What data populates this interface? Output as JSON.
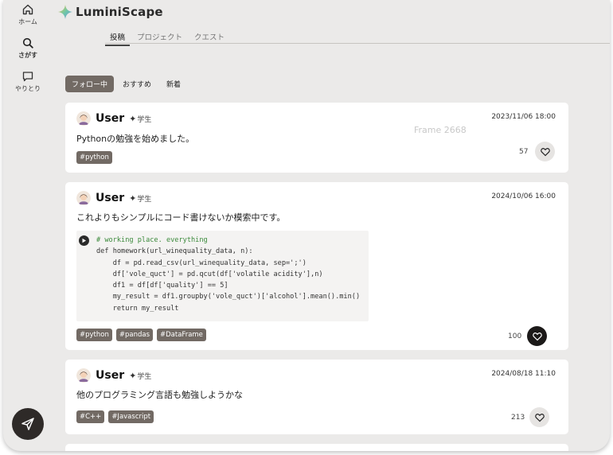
{
  "app": {
    "name": "LuminiScape"
  },
  "sidebar": {
    "items": [
      {
        "label": "ホーム",
        "icon": "home-icon"
      },
      {
        "label": "さがす",
        "icon": "search-icon"
      },
      {
        "label": "やりとり",
        "icon": "chat-icon"
      }
    ],
    "fab_icon": "send-icon"
  },
  "topnav": {
    "tabs": [
      "投稿",
      "プロジェクト",
      "クエスト"
    ],
    "active": 0
  },
  "filters": {
    "tabs": [
      "フォロー中",
      "おすすめ",
      "新着"
    ],
    "active": 0
  },
  "frame_label": "Frame 2668",
  "colors": {
    "tag_bg": "#726a64",
    "background": "#ebeae9",
    "liked": "#1c1a19"
  },
  "posts": [
    {
      "user": "User",
      "role": "学生",
      "date": "2023/11/06 18:00",
      "text": "Pythonの勉強を始めました。",
      "tags": [
        "#python"
      ],
      "likes": "57",
      "liked": false
    },
    {
      "user": "User",
      "role": "学生",
      "date": "2024/10/06 16:00",
      "text": "これよりもシンプルにコード書けないか模索中です。",
      "code": [
        "# working place. everything",
        "def homework(url_winequality_data, n):",
        "    df = pd.read_csv(url_winequality_data, sep=';')",
        "    df['vole_quct'] = pd.qcut(df['volatile acidity'],n)",
        "    df1 = df[df['quality'] == 5]",
        "    my_result = df1.groupby('vole_quct')['alcohol'].mean().min()",
        "    return my_result"
      ],
      "tags": [
        "#python",
        "#pandas",
        "#DataFrame"
      ],
      "likes": "100",
      "liked": true
    },
    {
      "user": "User",
      "role": "学生",
      "date": "2024/08/18 11:10",
      "text": "他のプログラミング言語も勉強しようかな",
      "tags": [
        "#C++",
        "#Javascript"
      ],
      "likes": "213",
      "liked": false
    }
  ]
}
